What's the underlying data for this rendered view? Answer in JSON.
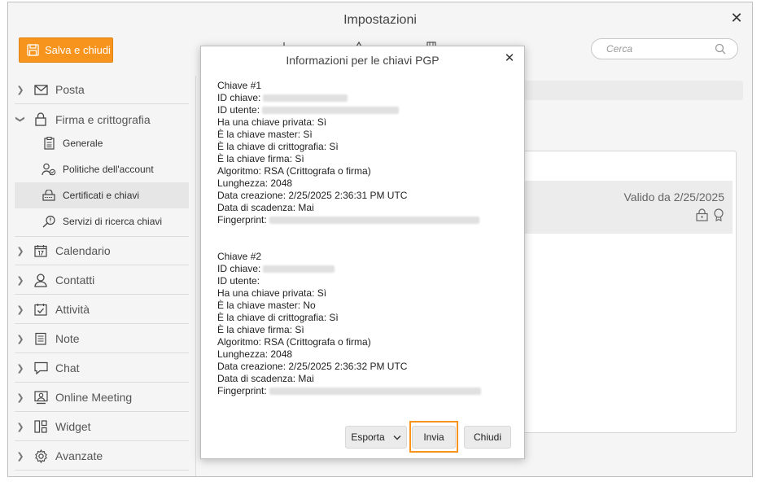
{
  "window": {
    "title": "Impostazioni"
  },
  "toolbar": {
    "save_label": "Salva e chiudi",
    "search_placeholder": "Cerca"
  },
  "sidebar": {
    "items": [
      {
        "label": "Posta",
        "icon": "envelope-icon"
      },
      {
        "label": "Firma e crittografia",
        "icon": "lock-icon",
        "expanded": true
      },
      {
        "label": "Calendario",
        "icon": "calendar-icon"
      },
      {
        "label": "Contatti",
        "icon": "person-icon"
      },
      {
        "label": "Attività",
        "icon": "checkbox-icon"
      },
      {
        "label": "Note",
        "icon": "note-icon"
      },
      {
        "label": "Chat",
        "icon": "chat-icon"
      },
      {
        "label": "Online Meeting",
        "icon": "meeting-icon"
      },
      {
        "label": "Widget",
        "icon": "widget-icon"
      },
      {
        "label": "Avanzate",
        "icon": "gear-icon"
      }
    ],
    "subitems": [
      {
        "label": "Generale",
        "icon": "clipboard-icon"
      },
      {
        "label": "Politiche dell'account",
        "icon": "user-policy-icon"
      },
      {
        "label": "Certificati e chiavi",
        "icon": "certificate-icon",
        "active": true
      },
      {
        "label": "Servizi di ricerca chiavi",
        "icon": "key-search-icon"
      }
    ]
  },
  "content": {
    "valid_from": "Valido da 2/25/2025"
  },
  "dialog": {
    "title": "Informazioni per le chiavi PGP",
    "keys": [
      {
        "header": "Chiave #1",
        "id_key": "ID chiave:",
        "id_user": "ID utente:",
        "private": "Ha una chiave privata: Sì",
        "master": "È la chiave master: Sì",
        "crypto": "È la chiave di crittografia: Sì",
        "sign": "È la chiave firma: Sì",
        "algo": "Algoritmo: RSA (Crittografa o firma)",
        "length": "Lunghezza: 2048",
        "created": "Data creazione: 2/25/2025 2:36:31 PM UTC",
        "expiry": "Data di scadenza: Mai",
        "fingerprint": "Fingerprint:"
      },
      {
        "header": "Chiave #2",
        "id_key": "ID chiave:",
        "id_user": "ID utente:",
        "private": "Ha una chiave privata: Sì",
        "master": "È la chiave master: No",
        "crypto": "È la chiave di crittografia: Sì",
        "sign": "È la chiave firma: Sì",
        "algo": "Algoritmo: RSA (Crittografa o firma)",
        "length": "Lunghezza: 2048",
        "created": "Data creazione: 2/25/2025 2:36:32 PM UTC",
        "expiry": "Data di scadenza: Mai",
        "fingerprint": "Fingerprint:"
      }
    ],
    "buttons": {
      "export": "Esporta",
      "send": "Invia",
      "close": "Chiudi"
    }
  },
  "colors": {
    "accent": "#f7941d"
  }
}
